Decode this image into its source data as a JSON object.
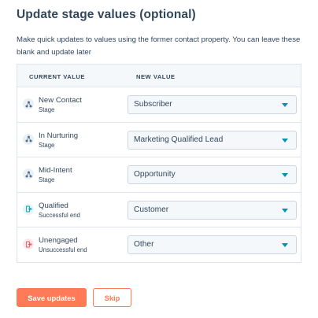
{
  "header": {
    "title": "Update stage values (optional)",
    "description": "Make quick updates to values using the former contact property. You can leave these blank and update later"
  },
  "table": {
    "col_current": "CURRENT VALUE",
    "col_new": "NEW VALUE",
    "rows": [
      {
        "name": "New Contact",
        "sub": "Stage",
        "icon": "network-icon",
        "selected": "Subscriber"
      },
      {
        "name": "In Nurturing",
        "sub": "Stage",
        "icon": "network-icon",
        "selected": "Marketing Qualified Lead"
      },
      {
        "name": "Mid-Intent",
        "sub": "Stage",
        "icon": "network-icon",
        "selected": "Opportunity"
      },
      {
        "name": "Qualified",
        "sub": "Successful end",
        "icon": "success-exit-icon",
        "selected": "Customer"
      },
      {
        "name": "Unengaged",
        "sub": "Unsuccessful end",
        "icon": "fail-exit-icon",
        "selected": "Other"
      }
    ]
  },
  "footer": {
    "save_label": "Save updates",
    "skip_label": "Skip"
  },
  "colors": {
    "primary": "#ff7a59",
    "text": "#33475b",
    "caret": "#0091ae",
    "border": "#dfe3eb",
    "success_icon": "#00a4bd",
    "fail_icon": "#f2545b"
  }
}
